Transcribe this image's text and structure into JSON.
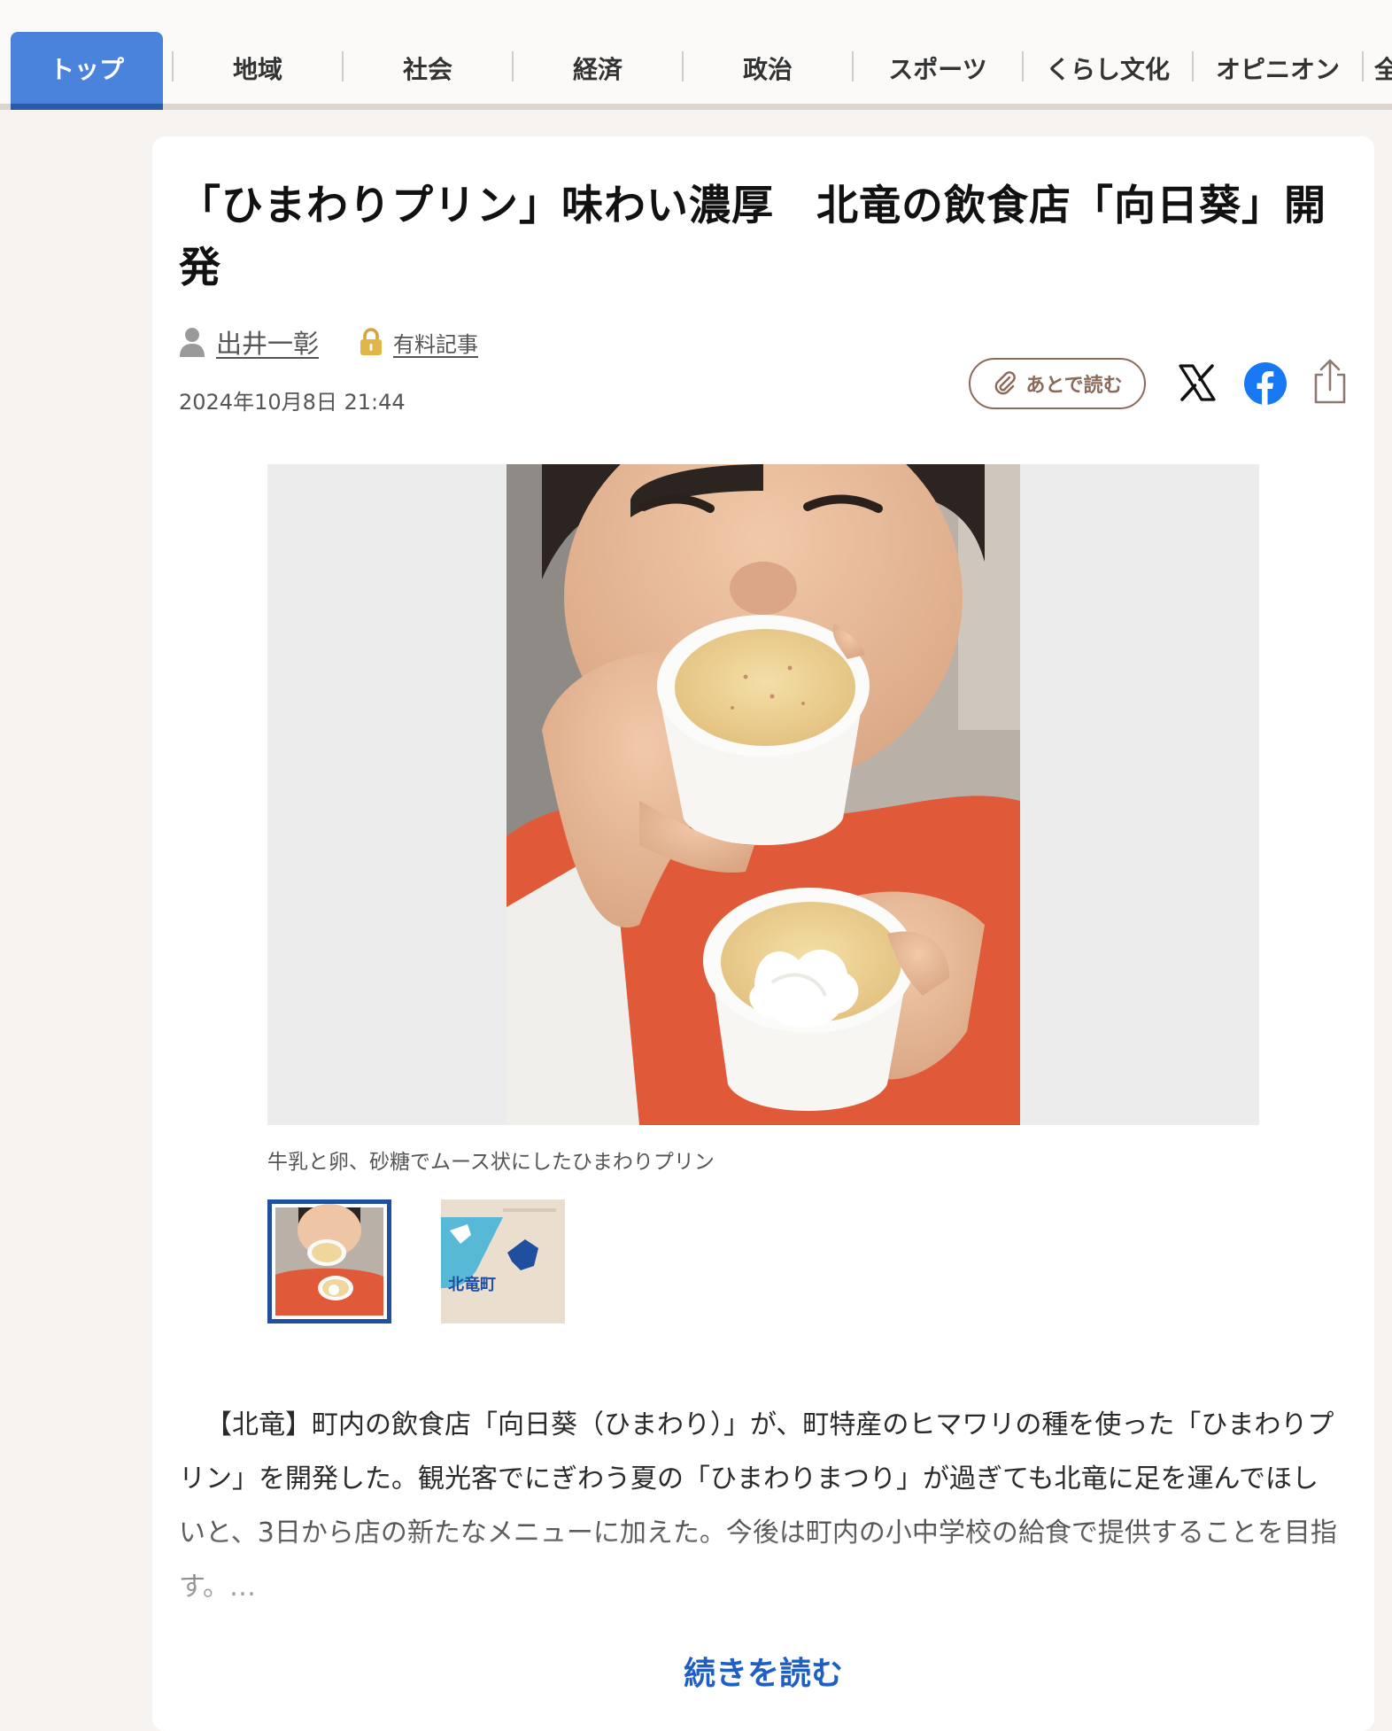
{
  "nav": {
    "tabs": [
      {
        "label": "トップ",
        "active": true
      },
      {
        "label": "地域",
        "active": false
      },
      {
        "label": "社会",
        "active": false
      },
      {
        "label": "経済",
        "active": false
      },
      {
        "label": "政治",
        "active": false
      },
      {
        "label": "スポーツ",
        "active": false
      },
      {
        "label": "くらし文化",
        "active": false
      },
      {
        "label": "オピニオン",
        "active": false
      },
      {
        "label": "全",
        "active": false
      }
    ]
  },
  "article": {
    "title": "「ひまわりプリン」味わい濃厚　北竜の飲食店「向日葵」開発",
    "author": "出井一彰",
    "author_icon": "person-icon",
    "paid_label": "有料記事",
    "paid_icon": "lock-icon",
    "date": "2024年10月8日 21:44",
    "read_later_label": "あとで読む",
    "share_icons": [
      "x-logo-icon",
      "facebook-icon",
      "share-icon"
    ],
    "photo_caption": "牛乳と卵、砂糖でムース状にしたひまわりプリン",
    "thumbnails": [
      {
        "icon": "photo-thumbnail",
        "selected": true
      },
      {
        "icon": "map-thumbnail",
        "label": "北竜町",
        "selected": false
      }
    ],
    "body": "【北竜】町内の飲食店「向日葵（ひまわり）」が、町特産のヒマワリの種を使った「ひまわりプリン」を開発した。観光客でにぎわう夏の「ひまわりまつり」が過ぎても北竜に足を運んでほしいと、3日から店の新たなメニューに加えた。今後は町内の小中学校の給食で提供することを目指す。…",
    "read_more_label": "続きを読む"
  },
  "colors": {
    "nav_active_bg": "#4a83dc",
    "accent_blue": "#1f5fc4",
    "thumb_border": "#1f4f9e",
    "read_later_border": "#8a6a5a",
    "facebook_blue": "#1877f2"
  }
}
